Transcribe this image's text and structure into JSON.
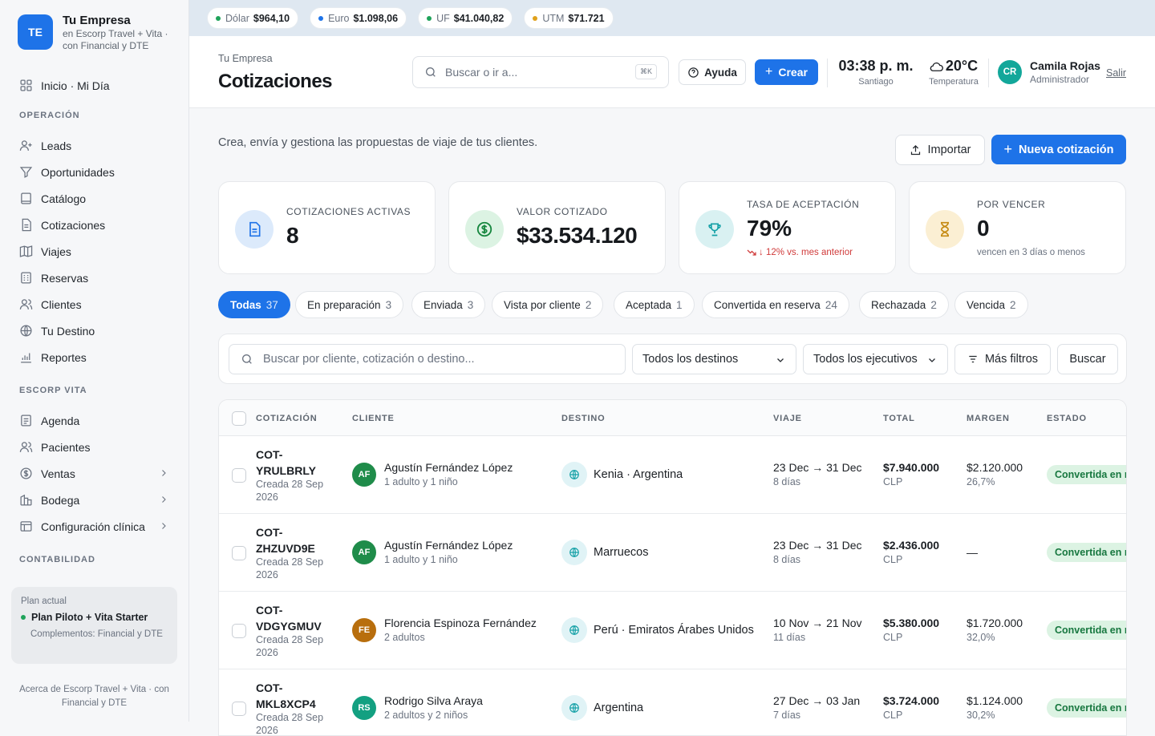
{
  "brand": {
    "initials": "TE",
    "name": "Tu Empresa",
    "subtitle": "en Escorp Travel + Vita · con Financial y DTE"
  },
  "sidebar": {
    "home": "Inicio · Mi Día",
    "section_operacion": "OPERACIÓN",
    "operacion": [
      "Leads",
      "Oportunidades",
      "Catálogo",
      "Cotizaciones",
      "Viajes",
      "Reservas",
      "Clientes",
      "Tu Destino",
      "Reportes"
    ],
    "section_vita": "ESCORP VITA",
    "vita": [
      "Agenda",
      "Pacientes",
      "Ventas",
      "Bodega",
      "Configuración clínica"
    ],
    "section_contabilidad": "CONTABILIDAD",
    "plan": {
      "label": "Plan actual",
      "name": "Plan Piloto + Vita Starter",
      "addons": "Complementos: Financial y DTE"
    },
    "about": "Acerca de Escorp Travel + Vita · con Financial y DTE"
  },
  "rates": [
    {
      "label": "Dólar",
      "value": "$964,10",
      "color": "#1fa35a"
    },
    {
      "label": "Euro",
      "value": "$1.098,06",
      "color": "#1e73e8"
    },
    {
      "label": "UF",
      "value": "$41.040,82",
      "color": "#1fa35a"
    },
    {
      "label": "UTM",
      "value": "$71.721",
      "color": "#e0a11b"
    }
  ],
  "header": {
    "breadcrumb": "Tu Empresa",
    "title": "Cotizaciones",
    "search_placeholder": "Buscar o ir a...",
    "search_shortcut": "⌘K",
    "help": "Ayuda",
    "create": "Crear",
    "time": "03:38 p. m.",
    "city": "Santiago",
    "temp": "20°C",
    "temp_label": "Temperatura",
    "user_initials": "CR",
    "user_name": "Camila Rojas",
    "user_role": "Administrador",
    "logout": "Salir"
  },
  "main": {
    "description": "Crea, envía y gestiona las propuestas de viaje de tus clientes.",
    "import": "Importar",
    "new_quote": "Nueva cotización"
  },
  "stats": [
    {
      "label": "COTIZACIONES ACTIVAS",
      "value": "8"
    },
    {
      "label": "VALOR COTIZADO",
      "value": "$33.534.120"
    },
    {
      "label": "TASA DE ACEPTACIÓN",
      "value": "79%",
      "foot": "↓ 12% vs. mes anterior"
    },
    {
      "label": "POR VENCER",
      "value": "0",
      "foot": "vencen en 3 días o menos"
    }
  ],
  "tabs": [
    {
      "label": "Todas",
      "count": "37"
    },
    {
      "label": "En preparación",
      "count": "3"
    },
    {
      "label": "Enviada",
      "count": "3"
    },
    {
      "label": "Vista por cliente",
      "count": "2"
    },
    {
      "label": "Aceptada",
      "count": "1"
    },
    {
      "label": "Convertida en reserva",
      "count": "24"
    },
    {
      "label": "Rechazada",
      "count": "2"
    },
    {
      "label": "Vencida",
      "count": "2"
    }
  ],
  "filters": {
    "search_placeholder": "Buscar por cliente, cotización o destino...",
    "destinations": "Todos los destinos",
    "executives": "Todos los ejecutivos",
    "more": "Más filtros",
    "search": "Buscar"
  },
  "table": {
    "columns": [
      "COTIZACIÓN",
      "CLIENTE",
      "DESTINO",
      "VIAJE",
      "TOTAL",
      "MARGEN",
      "ESTADO"
    ],
    "rows": [
      {
        "code": "COT-YRULBRLY",
        "created": "Creada 28 Sep 2026",
        "initials": "AF",
        "avatar_color": "#1f8c4a",
        "client": "Agustín Fernández López",
        "pax": "1 adulto y 1 niño",
        "destination": "Kenia · Argentina",
        "trip": "23 Dec → 31 Dec",
        "days": "8 días",
        "total": "$7.940.000",
        "currency": "CLP",
        "margin": "$2.120.000",
        "margin_pct": "26,7%",
        "status": "Convertida en reserva"
      },
      {
        "code": "COT-ZHZUVD9E",
        "created": "Creada 28 Sep 2026",
        "initials": "AF",
        "avatar_color": "#1f8c4a",
        "client": "Agustín Fernández López",
        "pax": "1 adulto y 1 niño",
        "destination": "Marruecos",
        "trip": "23 Dec → 31 Dec",
        "days": "8 días",
        "total": "$2.436.000",
        "currency": "CLP",
        "margin": "—",
        "margin_pct": "",
        "status": "Convertida en reserva"
      },
      {
        "code": "COT-VDGYGMUV",
        "created": "Creada 28 Sep 2026",
        "initials": "FE",
        "avatar_color": "#b86e0d",
        "client": "Florencia Espinoza Fernández",
        "pax": "2 adultos",
        "destination": "Perú · Emiratos Árabes Unidos",
        "trip": "10 Nov → 21 Nov",
        "days": "11 días",
        "total": "$5.380.000",
        "currency": "CLP",
        "margin": "$1.720.000",
        "margin_pct": "32,0%",
        "status": "Convertida en reserva"
      },
      {
        "code": "COT-MKL8XCP4",
        "created": "Creada 28 Sep 2026",
        "initials": "RS",
        "avatar_color": "#13a081",
        "client": "Rodrigo Silva Araya",
        "pax": "2 adultos y 2 niños",
        "destination": "Argentina",
        "trip": "27 Dec → 03 Jan",
        "days": "7 días",
        "total": "$3.724.000",
        "currency": "CLP",
        "margin": "$1.124.000",
        "margin_pct": "30,2%",
        "status": "Convertida en reserva"
      }
    ]
  }
}
